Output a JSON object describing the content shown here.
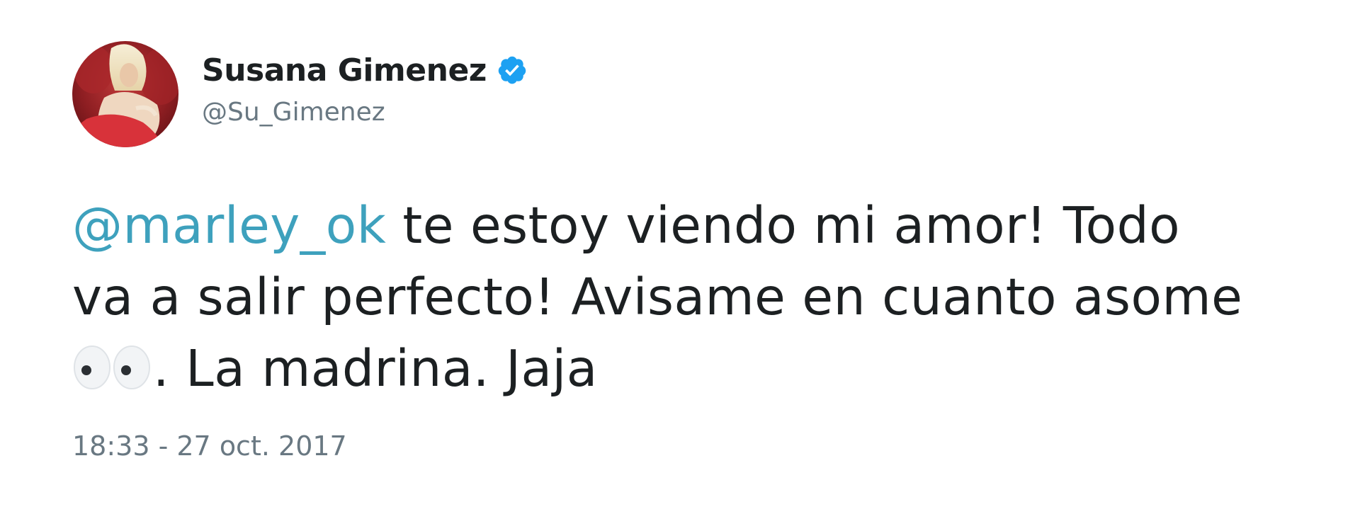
{
  "tweet": {
    "author": {
      "display_name": "Susana Gimenez",
      "handle": "@Su_Gimenez",
      "verified": true,
      "avatar_icon": "profile-photo"
    },
    "text": {
      "mention": "@marley_ok",
      "line1_rest": " te estoy viendo mi amor! Todo",
      "line2": "va a salir perfecto! Avisame en cuanto asome",
      "emoji_icon": "eyes-emoji",
      "line3_rest": ". La madrina. Jaja"
    },
    "timestamp": "18:33 - 27 oct. 2017"
  },
  "colors": {
    "text": "#1c2022",
    "secondary": "#697882",
    "mention": "#3ea1bd",
    "verified_badge": "#1da1f2"
  }
}
